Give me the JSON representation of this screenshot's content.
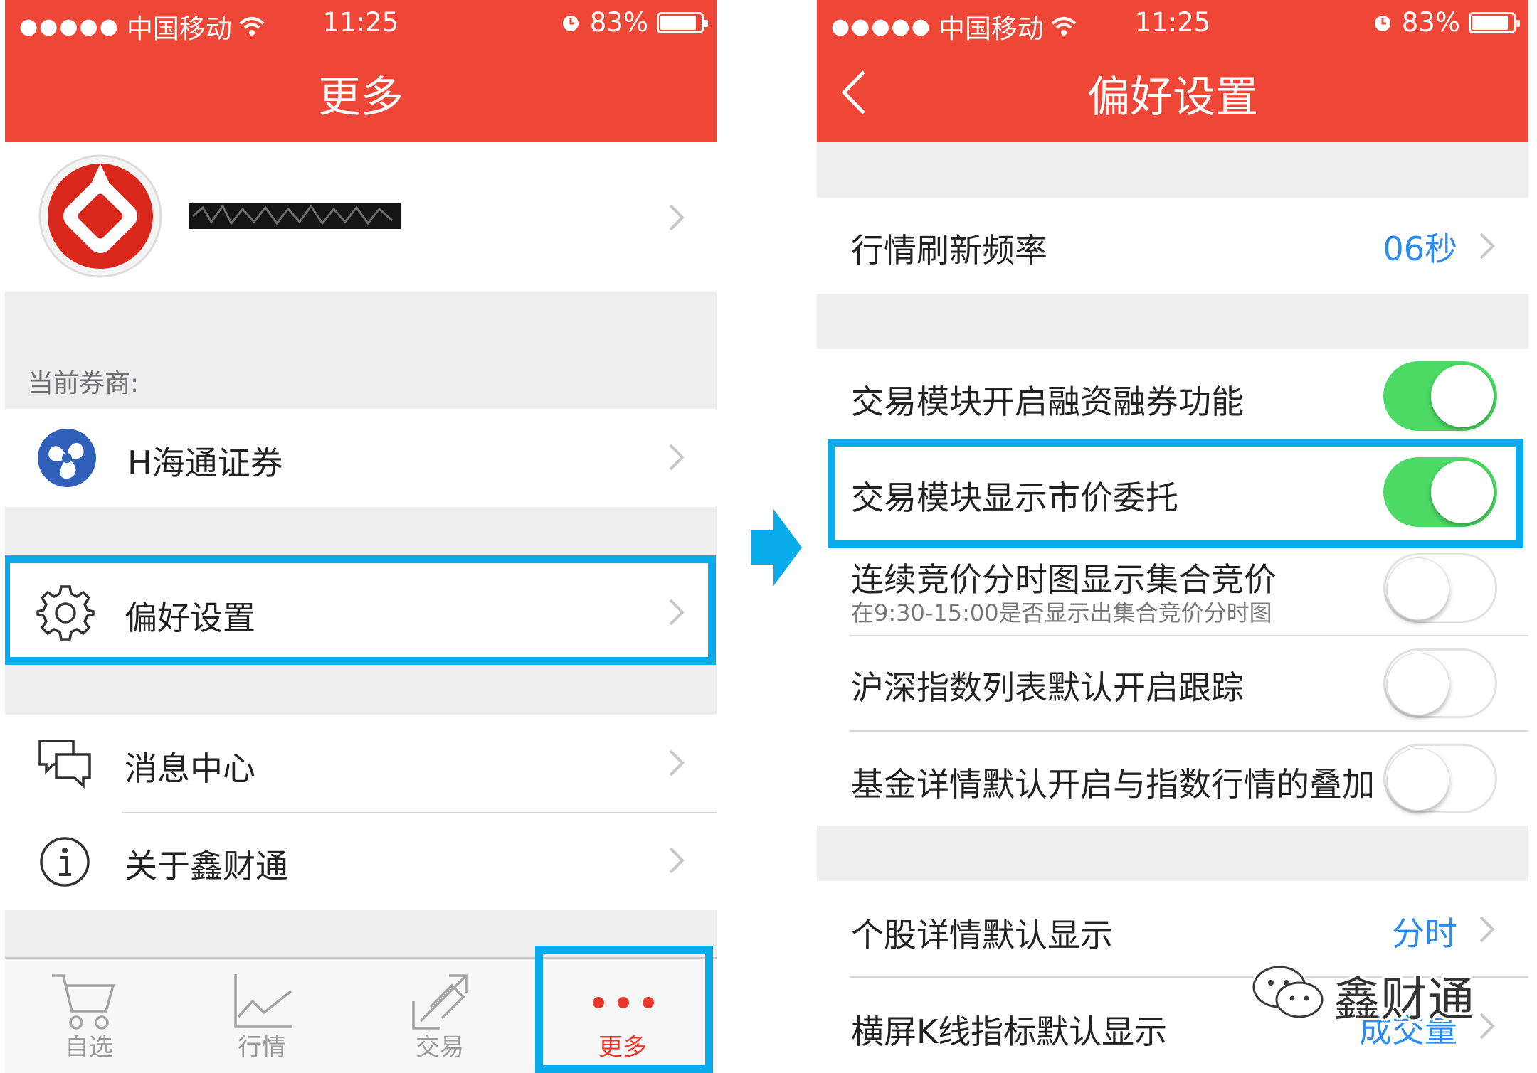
{
  "colors": {
    "nav_red": "#ee4738",
    "accent_blue": "#2d8cf0",
    "toggle_green": "#4cd964",
    "highlight_cyan": "#0aabea",
    "active_tab_red": "#e8382b"
  },
  "left": {
    "status": {
      "signal": "●●●●●",
      "carrier": "中国移动",
      "time": "11:25",
      "battery": "83%",
      "battery_level": 0.83
    },
    "nav_title": "更多",
    "account_chevron": "",
    "broker_section_label": "当前券商:",
    "broker_name": "H海通证券",
    "menu": {
      "preferences": "偏好设置",
      "messages": "消息中心",
      "about": "关于鑫财通"
    },
    "tabs": [
      {
        "label": "自选",
        "icon": "cart-icon"
      },
      {
        "label": "行情",
        "icon": "chart-line-icon"
      },
      {
        "label": "交易",
        "icon": "trade-arrows-icon"
      },
      {
        "label": "更多",
        "icon": "more-dots-icon",
        "active": true
      }
    ]
  },
  "right": {
    "status": {
      "signal": "●●●●●",
      "carrier": "中国移动",
      "time": "11:25",
      "battery": "83%",
      "battery_level": 0.83
    },
    "nav_title": "偏好设置",
    "refresh": {
      "label": "行情刷新频率",
      "value": "06秒"
    },
    "toggles": [
      {
        "label": "交易模块开启融资融券功能",
        "on": true
      },
      {
        "label": "交易模块显示市价委托",
        "on": true
      },
      {
        "label": "连续竞价分时图显示集合竞价",
        "sub": "在9:30-15:00是否显示出集合竞价分时图",
        "on": false
      },
      {
        "label": "沪深指数列表默认开启跟踪",
        "on": false
      },
      {
        "label": "基金详情默认开启与指数行情的叠加",
        "on": false
      }
    ],
    "stock_detail": {
      "label": "个股详情默认显示",
      "value": "分时"
    },
    "kline": {
      "label": "横屏K线指标默认显示",
      "value": "成交量"
    },
    "watermark": "鑫财通"
  }
}
